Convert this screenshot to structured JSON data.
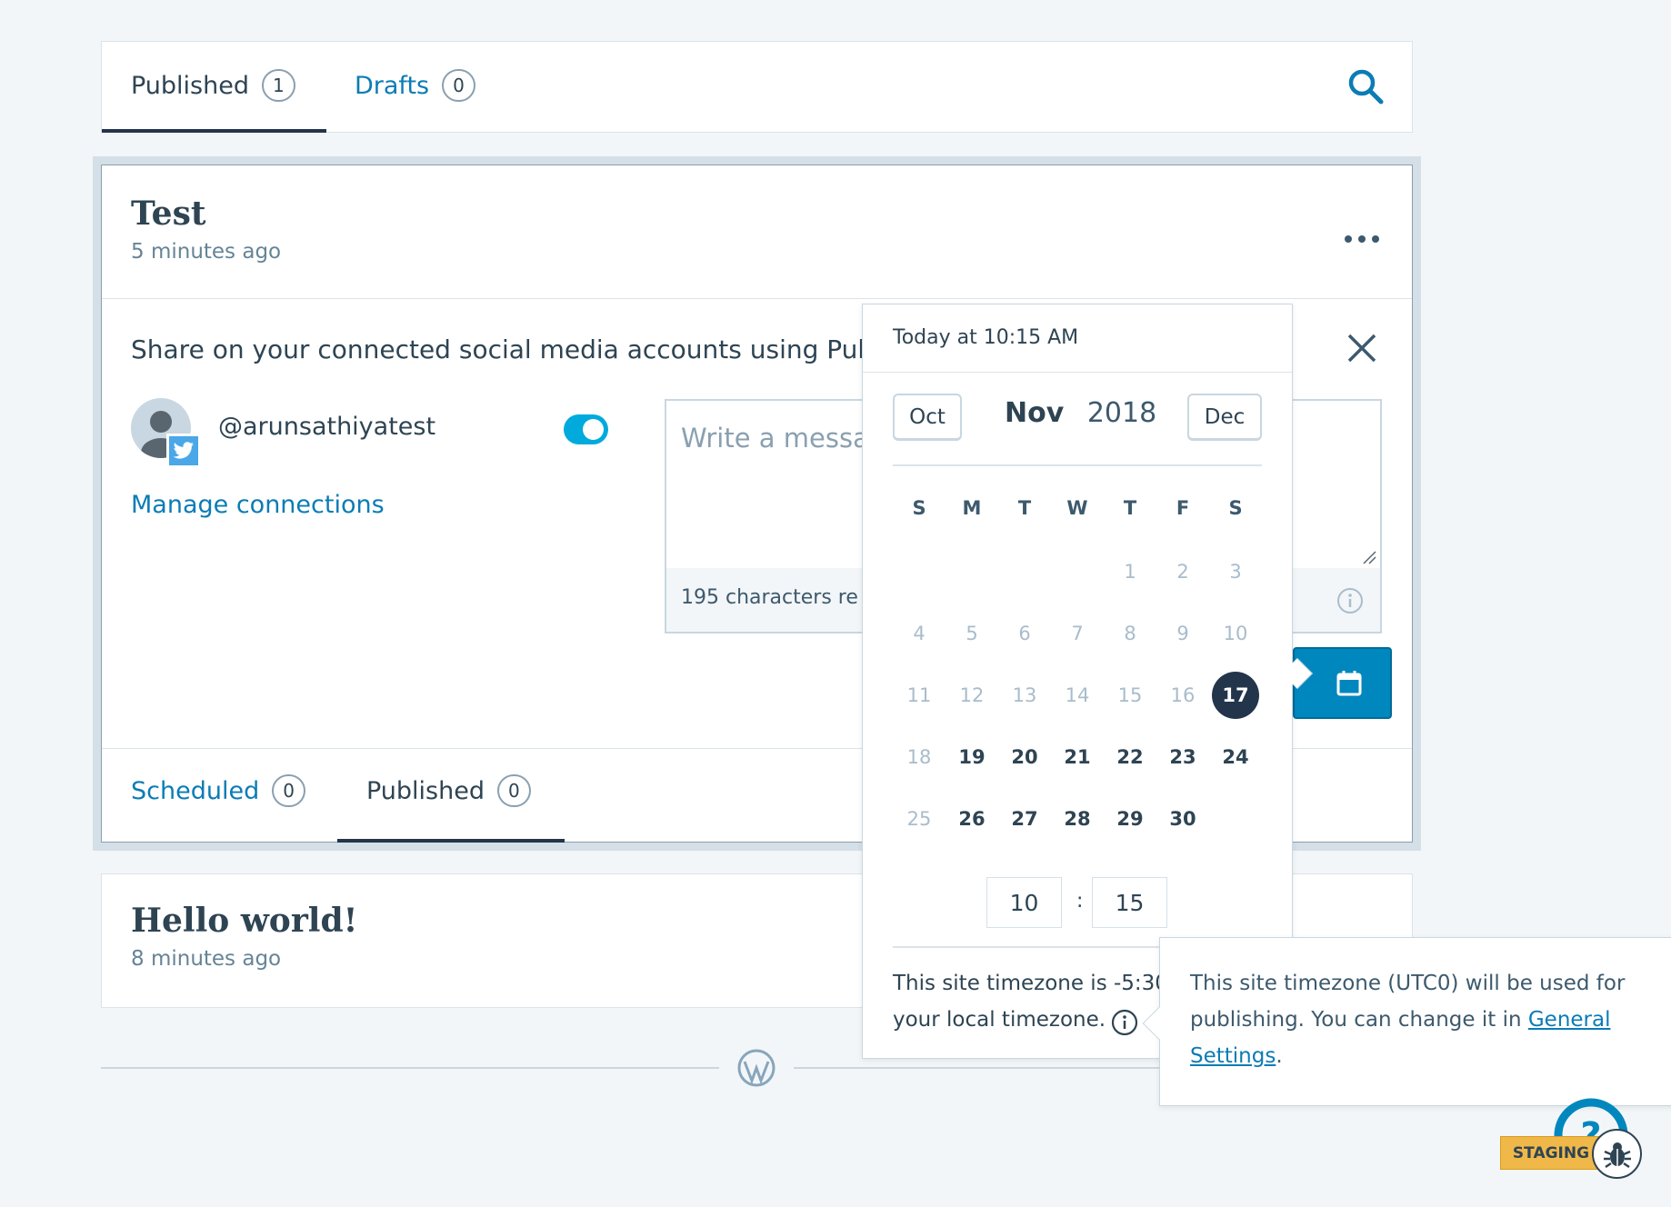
{
  "top_tabs": [
    {
      "label": "Published",
      "count": "1"
    },
    {
      "label": "Drafts",
      "count": "0"
    }
  ],
  "post1": {
    "title": "Test",
    "time": "5 minutes ago"
  },
  "share": {
    "intro": "Share on your connected social media accounts using Publ",
    "account": "@arunsathiyatest",
    "manage": "Manage connections",
    "message_placeholder": "Write a messa",
    "chars_remaining": "195 characters re"
  },
  "inner_tabs": [
    {
      "label": "Scheduled",
      "count": "0"
    },
    {
      "label": "Published",
      "count": "0"
    }
  ],
  "post2": {
    "title": "Hello world!",
    "time": "8 minutes ago"
  },
  "calendar": {
    "header": "Today at 10:15 AM",
    "prev": "Oct",
    "month": "Nov",
    "year": "2018",
    "next": "Dec",
    "weekdays": [
      "S",
      "M",
      "T",
      "W",
      "T",
      "F",
      "S"
    ],
    "selected_day": "17",
    "hour": "10",
    "minute": "15",
    "separator": ":",
    "tz_line1": "This site timezone is -5:30",
    "tz_line2": "your local timezone."
  },
  "tooltip": {
    "text": "This site timezone (UTC0) will be used for publishing. You can change it in ",
    "link1": "General",
    "link2": "Settings",
    "end": "."
  },
  "staging": "STAGING",
  "colors": {
    "accent": "#0b7cb5",
    "toggle": "#00aadc",
    "dark": "#23354b"
  }
}
